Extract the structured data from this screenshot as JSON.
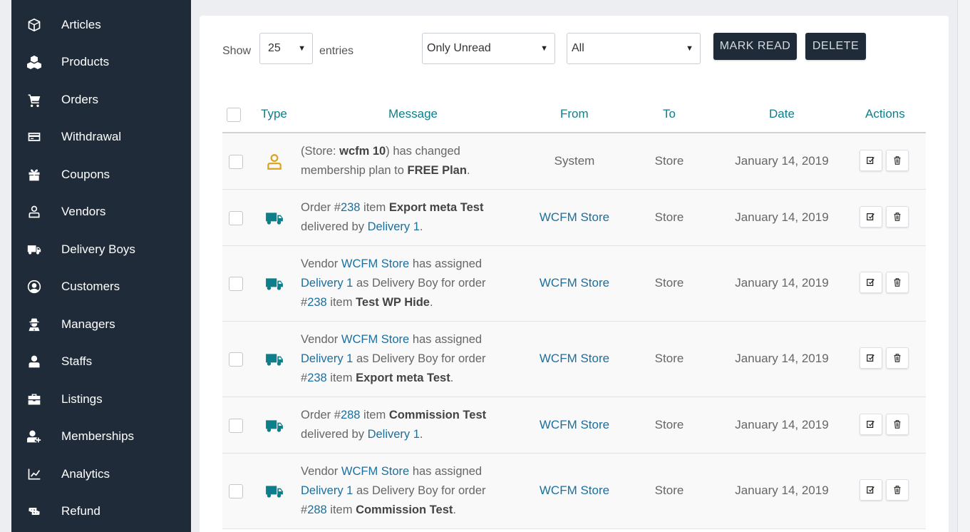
{
  "sidebar": {
    "items": [
      {
        "label": "Articles",
        "icon": "cube-icon"
      },
      {
        "label": "Products",
        "icon": "cubes-icon"
      },
      {
        "label": "Orders",
        "icon": "cart-icon"
      },
      {
        "label": "Withdrawal",
        "icon": "credit-card-icon"
      },
      {
        "label": "Coupons",
        "icon": "gift-icon"
      },
      {
        "label": "Vendors",
        "icon": "user-outline-icon"
      },
      {
        "label": "Delivery Boys",
        "icon": "truck-icon"
      },
      {
        "label": "Customers",
        "icon": "user-circle-icon"
      },
      {
        "label": "Managers",
        "icon": "user-secret-icon"
      },
      {
        "label": "Staffs",
        "icon": "user-icon"
      },
      {
        "label": "Listings",
        "icon": "briefcase-icon"
      },
      {
        "label": "Memberships",
        "icon": "user-plus-icon"
      },
      {
        "label": "Analytics",
        "icon": "line-chart-icon"
      },
      {
        "label": "Refund",
        "icon": "retweet-icon"
      }
    ]
  },
  "controls": {
    "show_label": "Show",
    "page_size": "25",
    "entries_label": "entries",
    "read_filter": "Only Unread",
    "type_filter": "All",
    "mark_read_label": "MARK READ",
    "delete_label": "DELETE"
  },
  "table": {
    "headers": {
      "type": "Type",
      "message": "Message",
      "from": "From",
      "to": "To",
      "date": "Date",
      "actions": "Actions"
    },
    "rows": [
      {
        "type_icon": "user-outline-icon",
        "message": [
          {
            "t": "text",
            "v": "(Store: "
          },
          {
            "t": "b",
            "v": "wcfm 10"
          },
          {
            "t": "text",
            "v": ") has changed membership plan to "
          },
          {
            "t": "b",
            "v": "FREE Plan"
          },
          {
            "t": "text",
            "v": "."
          }
        ],
        "from": "System",
        "from_link": false,
        "to": "Store",
        "date": "January 14, 2019"
      },
      {
        "type_icon": "truck-icon",
        "message": [
          {
            "t": "text",
            "v": "Order #"
          },
          {
            "t": "a",
            "v": "238"
          },
          {
            "t": "text",
            "v": " item "
          },
          {
            "t": "b",
            "v": "Export meta Test"
          },
          {
            "t": "text",
            "v": " delivered by "
          },
          {
            "t": "a",
            "v": "Delivery 1"
          },
          {
            "t": "text",
            "v": "."
          }
        ],
        "from": "WCFM Store",
        "from_link": true,
        "to": "Store",
        "date": "January 14, 2019"
      },
      {
        "type_icon": "truck-icon",
        "message": [
          {
            "t": "text",
            "v": "Vendor "
          },
          {
            "t": "a",
            "v": "WCFM Store"
          },
          {
            "t": "text",
            "v": " has assigned "
          },
          {
            "t": "a",
            "v": "Delivery 1"
          },
          {
            "t": "text",
            "v": " as Delivery Boy for order #"
          },
          {
            "t": "a",
            "v": "238"
          },
          {
            "t": "text",
            "v": " item "
          },
          {
            "t": "b",
            "v": "Test WP Hide"
          },
          {
            "t": "text",
            "v": "."
          }
        ],
        "from": "WCFM Store",
        "from_link": true,
        "to": "Store",
        "date": "January 14, 2019"
      },
      {
        "type_icon": "truck-icon",
        "message": [
          {
            "t": "text",
            "v": "Vendor "
          },
          {
            "t": "a",
            "v": "WCFM Store"
          },
          {
            "t": "text",
            "v": " has assigned "
          },
          {
            "t": "a",
            "v": "Delivery 1"
          },
          {
            "t": "text",
            "v": " as Delivery Boy for order #"
          },
          {
            "t": "a",
            "v": "238"
          },
          {
            "t": "text",
            "v": " item "
          },
          {
            "t": "b",
            "v": "Export meta Test"
          },
          {
            "t": "text",
            "v": "."
          }
        ],
        "from": "WCFM Store",
        "from_link": true,
        "to": "Store",
        "date": "January 14, 2019"
      },
      {
        "type_icon": "truck-icon",
        "message": [
          {
            "t": "text",
            "v": "Order #"
          },
          {
            "t": "a",
            "v": "288"
          },
          {
            "t": "text",
            "v": " item "
          },
          {
            "t": "b",
            "v": "Commission Test"
          },
          {
            "t": "text",
            "v": " delivered by "
          },
          {
            "t": "a",
            "v": "Delivery 1"
          },
          {
            "t": "text",
            "v": "."
          }
        ],
        "from": "WCFM Store",
        "from_link": true,
        "to": "Store",
        "date": "January 14, 2019"
      },
      {
        "type_icon": "truck-icon",
        "message": [
          {
            "t": "text",
            "v": "Vendor "
          },
          {
            "t": "a",
            "v": "WCFM Store"
          },
          {
            "t": "text",
            "v": " has assigned "
          },
          {
            "t": "a",
            "v": "Delivery 1"
          },
          {
            "t": "text",
            "v": " as Delivery Boy for order #"
          },
          {
            "t": "a",
            "v": "288"
          },
          {
            "t": "text",
            "v": " item "
          },
          {
            "t": "b",
            "v": "Commission Test"
          },
          {
            "t": "text",
            "v": "."
          }
        ],
        "from": "WCFM Store",
        "from_link": true,
        "to": "Store",
        "date": "January 14, 2019"
      }
    ]
  },
  "colors": {
    "sidebar_bg": "#1f2b38",
    "accent_teal": "#0c7f8a",
    "link_blue": "#1b6f9e",
    "membership_icon": "#d9a21b"
  }
}
